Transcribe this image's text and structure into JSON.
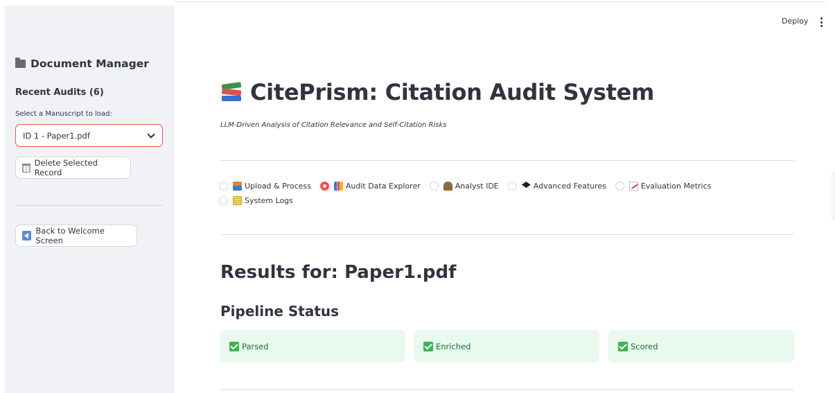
{
  "sidebar": {
    "header": "Document Manager",
    "header_icon": "folder-icon",
    "recent_audits": "Recent Audits (6)",
    "select_label": "Select a Manuscript to load:",
    "select_value": "ID 1 - Paper1.pdf",
    "delete_button": "Delete Selected Record",
    "back_button": "Back to Welcome Screen"
  },
  "toolbar": {
    "deploy": "Deploy"
  },
  "main": {
    "title": "CitePrism: Citation Audit System",
    "subtitle": "LLM-Driven Analysis of Citation Relevance and Self-Citation Risks",
    "nav": [
      {
        "label": "Upload & Process",
        "icon": "upload-icon",
        "selected": false
      },
      {
        "label": "Audit Data Explorer",
        "icon": "bar-chart-icon",
        "selected": true
      },
      {
        "label": "Analyst IDE",
        "icon": "detective-icon",
        "selected": false
      },
      {
        "label": "Advanced Features",
        "icon": "graduation-cap-icon",
        "selected": false
      },
      {
        "label": "Evaluation Metrics",
        "icon": "trend-chart-icon",
        "selected": false
      },
      {
        "label": "System Logs",
        "icon": "logs-icon",
        "selected": false
      }
    ],
    "results_heading": "Results for: Paper1.pdf",
    "pipeline_heading": "Pipeline Status",
    "pipeline_steps": [
      {
        "label": "Parsed",
        "status": "done"
      },
      {
        "label": "Enriched",
        "status": "done"
      },
      {
        "label": "Scored",
        "status": "done"
      }
    ]
  },
  "colors": {
    "accent": "#ff4b4b",
    "sidebar_bg": "#f0f2f6",
    "success_bg": "#e8f9ee",
    "success_text": "#177233"
  }
}
